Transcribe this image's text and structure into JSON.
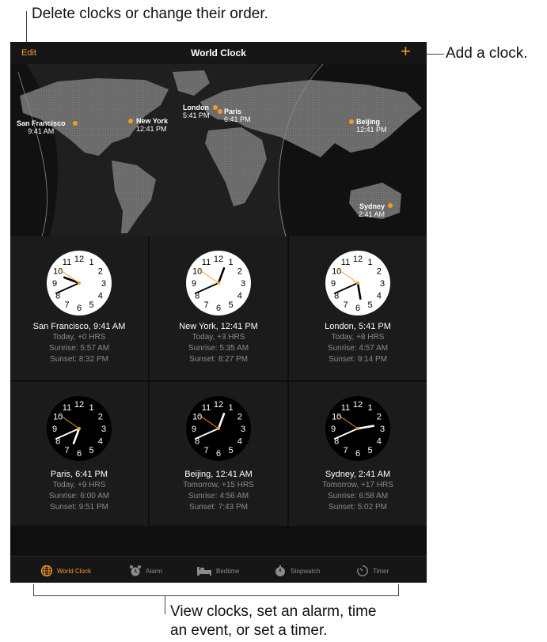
{
  "callouts": {
    "top": "Delete clocks or change their order.",
    "right": "Add a clock.",
    "bottom_line1": "View clocks, set an alarm, time",
    "bottom_line2": "an event, or set a timer."
  },
  "navbar": {
    "edit": "Edit",
    "title": "World Clock",
    "add": "+"
  },
  "map_cities": [
    {
      "name": "San Francisco",
      "time": "9:41 AM"
    },
    {
      "name": "New York",
      "time": "12:41 PM"
    },
    {
      "name": "London",
      "time": "5:41 PM"
    },
    {
      "name": "Paris",
      "time": "6:41 PM"
    },
    {
      "name": "Beijing",
      "time": "12:41 PM"
    },
    {
      "name": "Sydney",
      "time": "2:41 AM"
    }
  ],
  "clocks": [
    {
      "title": "San Francisco, 9:41 AM",
      "day": "Today, +0 HRS",
      "sunrise": "Sunrise: 5:57 AM",
      "sunset": "Sunset: 8:32 PM",
      "theme": "light",
      "hour": 9,
      "minute": 41
    },
    {
      "title": "New York, 12:41 PM",
      "day": "Today, +3 HRS",
      "sunrise": "Sunrise: 5:35 AM",
      "sunset": "Sunset: 8:27 PM",
      "theme": "light",
      "hour": 12,
      "minute": 41
    },
    {
      "title": "London, 5:41 PM",
      "day": "Today, +8 HRS",
      "sunrise": "Sunrise: 4:57 AM",
      "sunset": "Sunset: 9:14 PM",
      "theme": "light",
      "hour": 5,
      "minute": 41
    },
    {
      "title": "Paris, 6:41 PM",
      "day": "Today, +9 HRS",
      "sunrise": "Sunrise: 6:00 AM",
      "sunset": "Sunset: 9:51 PM",
      "theme": "dark",
      "hour": 6,
      "minute": 41
    },
    {
      "title": "Beijing, 12:41 AM",
      "day": "Tomorrow, +15 HRS",
      "sunrise": "Sunrise: 4:56 AM",
      "sunset": "Sunset: 7:43 PM",
      "theme": "dark",
      "hour": 12,
      "minute": 41
    },
    {
      "title": "Sydney, 2:41 AM",
      "day": "Tomorrow, +17 HRS",
      "sunrise": "Sunrise: 6:58 AM",
      "sunset": "Sunset: 5:02 PM",
      "theme": "dark",
      "hour": 2,
      "minute": 41
    }
  ],
  "dial_numbers": [
    "12",
    "1",
    "2",
    "3",
    "4",
    "5",
    "6",
    "7",
    "8",
    "9",
    "10",
    "11"
  ],
  "tabs": [
    {
      "label": "World Clock",
      "icon": "globe-icon",
      "active": true
    },
    {
      "label": "Alarm",
      "icon": "alarm-icon",
      "active": false
    },
    {
      "label": "Bedtime",
      "icon": "bed-icon",
      "active": false
    },
    {
      "label": "Stopwatch",
      "icon": "stopwatch-icon",
      "active": false
    },
    {
      "label": "Timer",
      "icon": "timer-icon",
      "active": false
    }
  ],
  "colors": {
    "accent": "#f59b22",
    "background": "#0f0f0f",
    "cell": "#1b1b1b",
    "secondary_text": "#8a8a8a"
  }
}
